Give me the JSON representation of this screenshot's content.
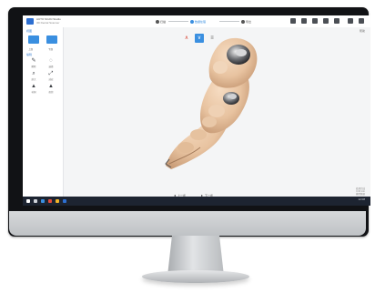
{
  "app": {
    "title": "AUTO SCAN Studio",
    "subtitle": "3D Dental Scanner"
  },
  "workflow": {
    "steps": [
      {
        "label": "扫描",
        "active": false
      },
      {
        "label": "数据处理",
        "active": true
      },
      {
        "label": "导出",
        "active": false
      }
    ]
  },
  "toolbar_icons": [
    "save-icon",
    "undo-icon",
    "settings-icon",
    "share-icon",
    "help-icon",
    "minimize-icon",
    "close-icon"
  ],
  "panel": {
    "view_label": "视图",
    "view_buttons": [
      "上颌",
      "下颌"
    ],
    "edit_label": "编辑",
    "tools": [
      {
        "name": "brush",
        "glyph": "✎",
        "label": "擦除"
      },
      {
        "name": "lasso",
        "glyph": "◌",
        "label": "选择"
      },
      {
        "name": "zoom",
        "glyph": "⌕",
        "label": "放大"
      },
      {
        "name": "fit",
        "glyph": "⤢",
        "label": "适应"
      },
      {
        "name": "fill",
        "glyph": "▲",
        "label": "补洞"
      },
      {
        "name": "trim",
        "glyph": "▲",
        "label": "修剪"
      }
    ]
  },
  "view_tools": {
    "red_label": "∧",
    "blue_label": "∨",
    "gray_label": "≡"
  },
  "actions": {
    "back": "上一步",
    "next": "下一步"
  },
  "corner": "帮助",
  "status_lines": [
    "处理完成",
    "0.00 mm",
    "模型数据"
  ],
  "tray": "12:08",
  "colors": {
    "accent": "#3a8fe0",
    "scan_surface": "#e8c3a0",
    "scan_shadow": "#b08866",
    "taskbar": "#1d2431"
  }
}
